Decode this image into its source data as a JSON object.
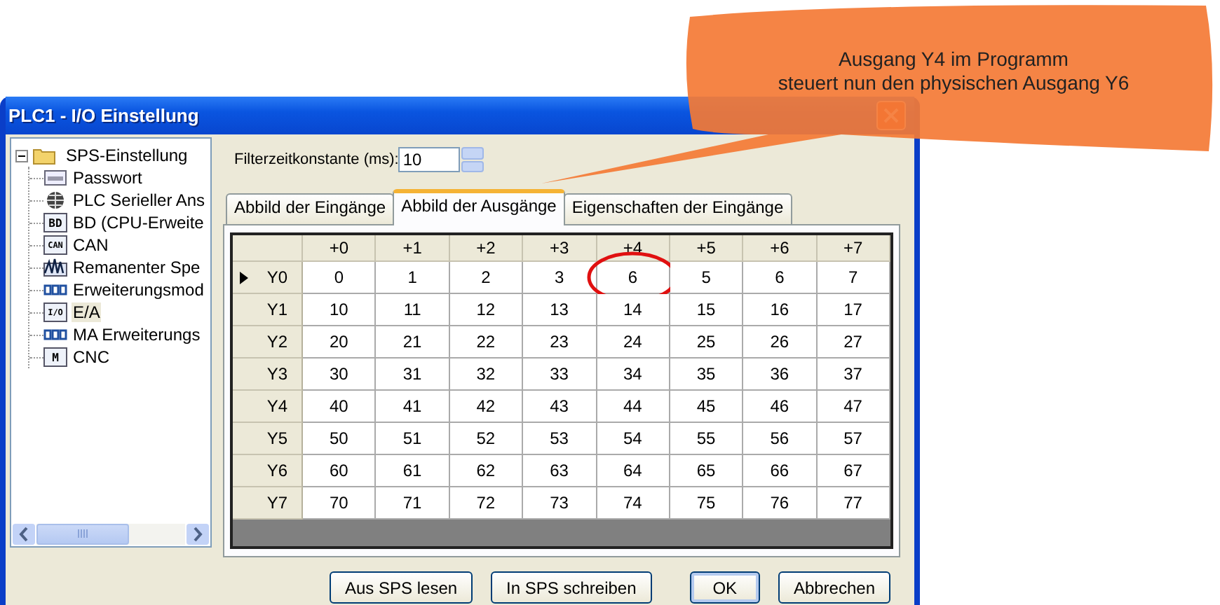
{
  "window": {
    "title": "PLC1 - I/O  Einstellung"
  },
  "tree": {
    "label": "SPS-Einstellung",
    "expanded": true,
    "children": [
      {
        "label": "Passwort",
        "kind": "password",
        "selected": false
      },
      {
        "label": "PLC Serieller Ans",
        "kind": "globe",
        "selected": false
      },
      {
        "label": "BD (CPU-Erweite",
        "kind": "badge",
        "badge": "BD",
        "selected": false
      },
      {
        "label": "CAN",
        "kind": "badge",
        "badge": "CAN",
        "selected": false
      },
      {
        "label": "Remanenter Spe",
        "kind": "wave",
        "selected": false
      },
      {
        "label": "Erweiterungsmod",
        "kind": "module",
        "selected": false
      },
      {
        "label": "E/A",
        "kind": "badge",
        "badge": "I/O",
        "selected": true
      },
      {
        "label": "MA Erweiterungs",
        "kind": "module",
        "selected": false
      },
      {
        "label": "CNC",
        "kind": "badge",
        "badge": "M",
        "selected": false
      }
    ]
  },
  "filter": {
    "label": "Filterzeitkonstante (ms):",
    "value": "10"
  },
  "tabs": [
    {
      "label": "Abbild der Eingänge",
      "selected": false
    },
    {
      "label": "Abbild der Ausgänge",
      "selected": true
    },
    {
      "label": "Eigenschaften der Eingänge",
      "selected": false
    }
  ],
  "table": {
    "columns": [
      "+0",
      "+1",
      "+2",
      "+3",
      "+4",
      "+5",
      "+6",
      "+7"
    ],
    "rows": [
      {
        "label": "Y0",
        "current": true,
        "cells": [
          {
            "text": "0",
            "circled": false
          },
          {
            "text": "1",
            "circled": false
          },
          {
            "text": "2",
            "circled": false
          },
          {
            "text": "3",
            "circled": false
          },
          {
            "text": "6",
            "circled": true
          },
          {
            "text": "5",
            "circled": false
          },
          {
            "text": "6",
            "circled": false
          },
          {
            "text": "7",
            "circled": false
          }
        ]
      },
      {
        "label": "Y1",
        "current": false,
        "cells": [
          {
            "text": "10",
            "circled": false
          },
          {
            "text": "11",
            "circled": false
          },
          {
            "text": "12",
            "circled": false
          },
          {
            "text": "13",
            "circled": false
          },
          {
            "text": "14",
            "circled": false
          },
          {
            "text": "15",
            "circled": false
          },
          {
            "text": "16",
            "circled": false
          },
          {
            "text": "17",
            "circled": false
          }
        ]
      },
      {
        "label": "Y2",
        "current": false,
        "cells": [
          {
            "text": "20",
            "circled": false
          },
          {
            "text": "21",
            "circled": false
          },
          {
            "text": "22",
            "circled": false
          },
          {
            "text": "23",
            "circled": false
          },
          {
            "text": "24",
            "circled": false
          },
          {
            "text": "25",
            "circled": false
          },
          {
            "text": "26",
            "circled": false
          },
          {
            "text": "27",
            "circled": false
          }
        ]
      },
      {
        "label": "Y3",
        "current": false,
        "cells": [
          {
            "text": "30",
            "circled": false
          },
          {
            "text": "31",
            "circled": false
          },
          {
            "text": "32",
            "circled": false
          },
          {
            "text": "33",
            "circled": false
          },
          {
            "text": "34",
            "circled": false
          },
          {
            "text": "35",
            "circled": false
          },
          {
            "text": "36",
            "circled": false
          },
          {
            "text": "37",
            "circled": false
          }
        ]
      },
      {
        "label": "Y4",
        "current": false,
        "cells": [
          {
            "text": "40",
            "circled": false
          },
          {
            "text": "41",
            "circled": false
          },
          {
            "text": "42",
            "circled": false
          },
          {
            "text": "43",
            "circled": false
          },
          {
            "text": "44",
            "circled": false
          },
          {
            "text": "45",
            "circled": false
          },
          {
            "text": "46",
            "circled": false
          },
          {
            "text": "47",
            "circled": false
          }
        ]
      },
      {
        "label": "Y5",
        "current": false,
        "cells": [
          {
            "text": "50",
            "circled": false
          },
          {
            "text": "51",
            "circled": false
          },
          {
            "text": "52",
            "circled": false
          },
          {
            "text": "53",
            "circled": false
          },
          {
            "text": "54",
            "circled": false
          },
          {
            "text": "55",
            "circled": false
          },
          {
            "text": "56",
            "circled": false
          },
          {
            "text": "57",
            "circled": false
          }
        ]
      },
      {
        "label": "Y6",
        "current": false,
        "cells": [
          {
            "text": "60",
            "circled": false
          },
          {
            "text": "61",
            "circled": false
          },
          {
            "text": "62",
            "circled": false
          },
          {
            "text": "63",
            "circled": false
          },
          {
            "text": "64",
            "circled": false
          },
          {
            "text": "65",
            "circled": false
          },
          {
            "text": "66",
            "circled": false
          },
          {
            "text": "67",
            "circled": false
          }
        ]
      },
      {
        "label": "Y7",
        "current": false,
        "cells": [
          {
            "text": "70",
            "circled": false
          },
          {
            "text": "71",
            "circled": false
          },
          {
            "text": "72",
            "circled": false
          },
          {
            "text": "73",
            "circled": false
          },
          {
            "text": "74",
            "circled": false
          },
          {
            "text": "75",
            "circled": false
          },
          {
            "text": "76",
            "circled": false
          },
          {
            "text": "77",
            "circled": false
          }
        ]
      }
    ]
  },
  "buttons": [
    {
      "label": "Aus SPS lesen",
      "default": false
    },
    {
      "label": "In SPS schreiben",
      "default": false
    },
    {
      "label": "OK",
      "default": true
    },
    {
      "label": "Abbrechen",
      "default": false
    }
  ],
  "callout": {
    "lines": [
      "Ausgang Y4 im Programm",
      "steuert nun den physischen Ausgang Y6"
    ]
  }
}
